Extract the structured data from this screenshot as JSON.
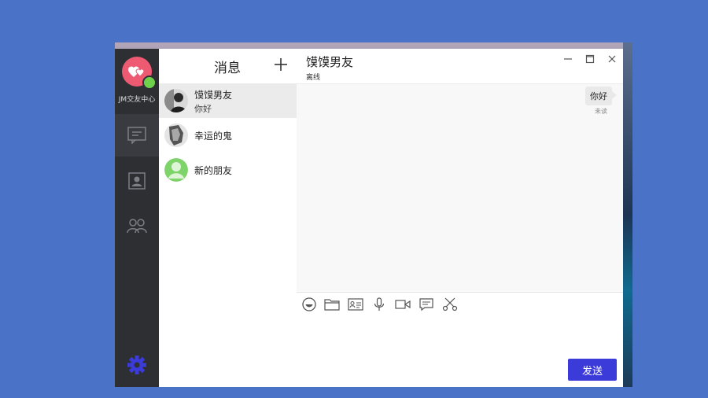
{
  "sidebar": {
    "app_name": "JM交友中心",
    "nav": [
      "messages-icon",
      "contacts-icon",
      "groups-icon",
      "settings-icon"
    ],
    "accent": "#3b3bd9"
  },
  "conversations": {
    "title": "消息",
    "items": [
      {
        "name": "馍馍男友",
        "preview": "你好"
      },
      {
        "name": "幸运的鬼",
        "preview": ""
      },
      {
        "name": "新的朋友",
        "preview": ""
      }
    ]
  },
  "chat": {
    "title": "馍馍男友",
    "status": "离线",
    "messages": [
      {
        "text": "你好",
        "status": "未读",
        "from": "me"
      }
    ],
    "tools": [
      "emoji-icon",
      "folder-icon",
      "contact-card-icon",
      "microphone-icon",
      "video-icon",
      "chat-bubble-icon",
      "scissors-icon"
    ],
    "send_label": "发送"
  },
  "colors": {
    "logo": "#ef5a73",
    "online": "#6fd04c",
    "send": "#3b3bd9"
  }
}
